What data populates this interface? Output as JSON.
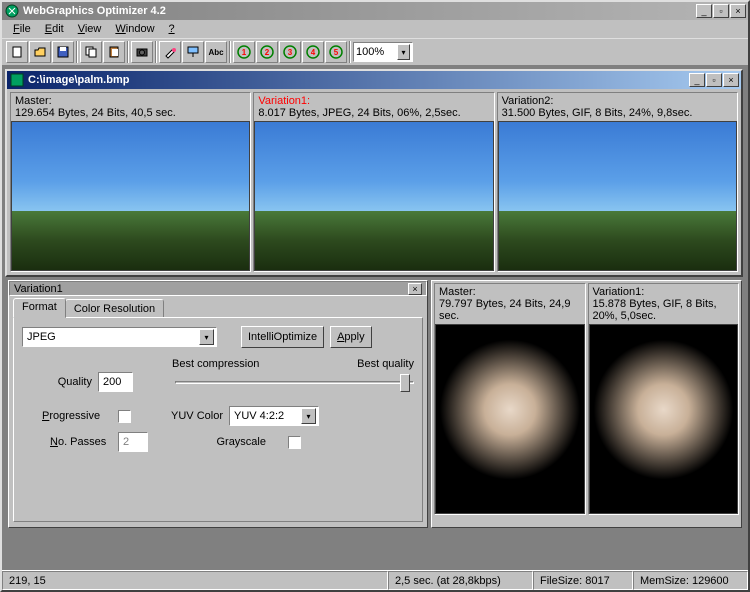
{
  "app": {
    "title": "WebGraphics Optimizer 4.2",
    "icon": "app-icon"
  },
  "menubar": [
    "File",
    "Edit",
    "View",
    "Window",
    "?"
  ],
  "toolbar": {
    "zoom": "100%"
  },
  "doc": {
    "path": "C:\\image\\palm.bmp",
    "previews": [
      {
        "name": "Master:",
        "info": "129.654 Bytes, 24 Bits, 40,5 sec.",
        "red": false
      },
      {
        "name": "Variation1:",
        "info": "8.017 Bytes, JPEG, 24 Bits, 06%, 2,5sec.",
        "red": true
      },
      {
        "name": "Variation2:",
        "info": "31.500 Bytes, GIF, 8 Bits, 24%, 9,8sec.",
        "red": false
      }
    ]
  },
  "options": {
    "panel_title": "Variation1",
    "tabs": [
      "Format",
      "Color Resolution"
    ],
    "active_tab": 0,
    "format_value": "JPEG",
    "btn_intelli": "IntelliOptimize",
    "btn_apply": "Apply",
    "quality_label": "Quality",
    "quality_value": "200",
    "slider_left": "Best compression",
    "slider_right": "Best quality",
    "progressive_label": "Progressive",
    "progressive": false,
    "no_passes_label": "No. Passes",
    "no_passes": "2",
    "yuv_label": "YUV Color",
    "yuv_value": "YUV 4:2:2",
    "grayscale_label": "Grayscale",
    "grayscale": false
  },
  "doc2": {
    "previews": [
      {
        "name": "Master:",
        "info": "79.797 Bytes, 24 Bits, 24,9 sec.",
        "red": false
      },
      {
        "name": "Variation1:",
        "info": "15.878 Bytes, GIF, 8 Bits, 20%, 5,0sec.",
        "red": true
      }
    ]
  },
  "statusbar": {
    "coords": "219, 15",
    "time": "2,5 sec. (at 28,8kbps)",
    "filesize": "FileSize: 8017",
    "memsize": "MemSize: 129600"
  }
}
